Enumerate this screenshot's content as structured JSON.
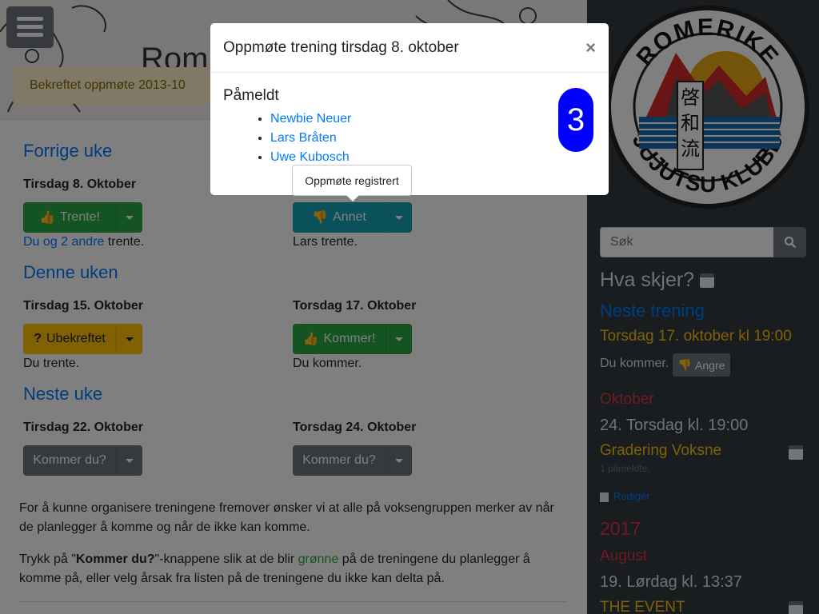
{
  "header": {
    "menu_icon": "hamburger-icon",
    "title_partial": "Rom",
    "alert": "Bekreftet oppmøte 2013-10"
  },
  "weeks": [
    {
      "heading": "Forrige uke",
      "days": [
        {
          "label": "Tirsdag 8. Oktober",
          "button": "Trente!",
          "icon": "thumbs-up-icon",
          "style": "green",
          "note_link": "Du og 2 andre",
          "note_rest": " trente."
        },
        {
          "label": "",
          "button": "Annet",
          "icon": "thumbs-down-icon",
          "style": "info",
          "note_link": "",
          "note_rest": "Lars trente."
        }
      ]
    },
    {
      "heading": "Denne uken",
      "days": [
        {
          "label": "Tirsdag 15. Oktober",
          "button": "Ubekreftet",
          "icon": "question-icon",
          "style": "warning",
          "note_link": "",
          "note_rest": "Du trente."
        },
        {
          "label": "Torsdag 17. Oktober",
          "button": "Kommer!",
          "icon": "thumbs-up-icon",
          "style": "green",
          "note_link": "",
          "note_rest": "Du kommer."
        }
      ]
    },
    {
      "heading": "Neste uke",
      "days": [
        {
          "label": "Tirsdag 22. Oktober",
          "button": "Kommer du?",
          "icon": "",
          "style": "gray",
          "note_link": "",
          "note_rest": ""
        },
        {
          "label": "Torsdag 24. Oktober",
          "button": "Kommer du?",
          "icon": "",
          "style": "gray",
          "note_link": "",
          "note_rest": ""
        }
      ]
    }
  ],
  "info": {
    "para1": "For å kunne organisere treningene fremover ønsker vi at alle på voksengruppen merker av når de planlegger å komme og når de ikke kan komme.",
    "para2_a": "Trykk på \"",
    "para2_b": "Kommer du?",
    "para2_c": "\"-knappene slik at de blir ",
    "para2_green": "grønne",
    "para2_d": " på de treningene du planlegger å komme på, eller velg årsak fra listen på de treningene du ikke kan delta på."
  },
  "sidebar": {
    "logo_text_top": "ROMERIKE",
    "logo_text_bottom": "JUJUTSU KLUBB",
    "logo_kanji": [
      "啓",
      "和",
      "流"
    ],
    "search_placeholder": "Søk",
    "hva_skjer": "Hva skjer?",
    "neste_trening": "Neste trening",
    "next_session": "Torsdag 17. oktober kl 19:00",
    "du_kommer": "Du kommer.",
    "angre": "Angre",
    "month1": "Oktober",
    "event1_date": "24. Torsdag kl. 19:00",
    "event1_title": "Gradering Voksne",
    "event1_count": "1 påmeldte.",
    "rediger": "Redigér",
    "year": "2017",
    "month2": "August",
    "event2_date": "19. Lørdag kl. 13:37",
    "event2_title": "THE EVENT"
  },
  "modal": {
    "title": "Oppmøte trening tirsdag 8. oktober",
    "close": "×",
    "section": "Påmeldt",
    "attendees": [
      "Newbie Neuer",
      "Lars Bråten",
      "Uwe Kubosch"
    ],
    "count": "3"
  },
  "tooltip": "Oppmøte registrert",
  "colors": {
    "primary": "#007bff",
    "success": "#28a745",
    "info": "#17a2b8",
    "warning": "#ffc107",
    "secondary": "#6c757d",
    "badge": "#0000ff",
    "logo_red": "#d42a2a",
    "logo_orange": "#e8a617"
  }
}
